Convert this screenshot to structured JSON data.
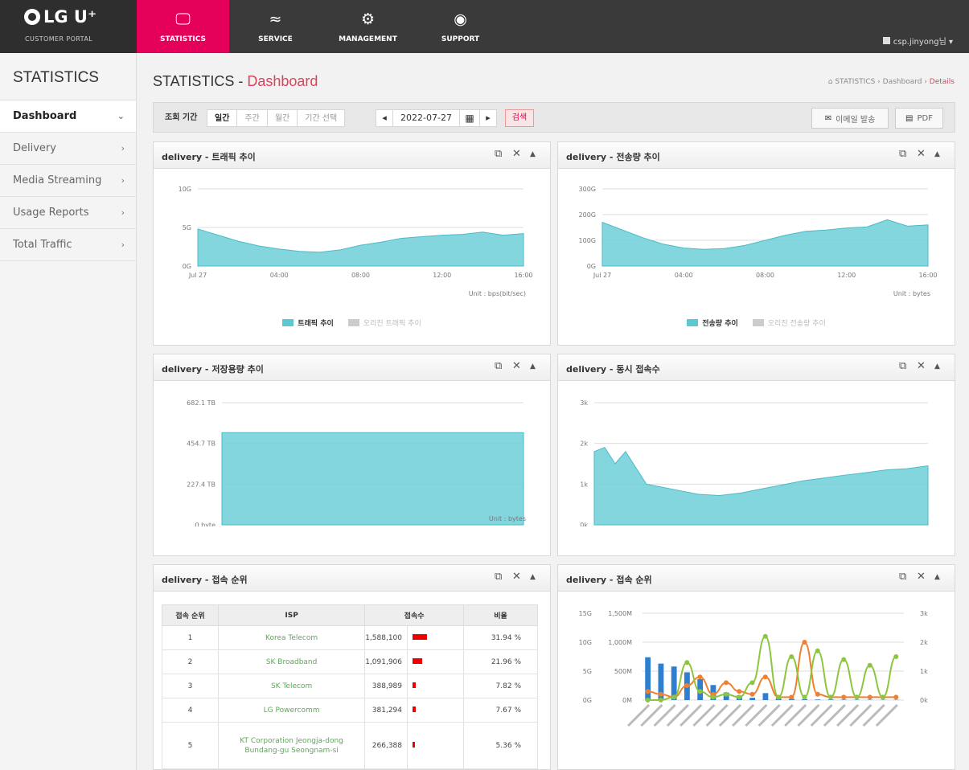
{
  "header": {
    "logo_text": "LG U⁺",
    "logo_sub": "CUSTOMER PORTAL",
    "nav": [
      {
        "label": "STATISTICS",
        "icon": "monitor-icon"
      },
      {
        "label": "SERVICE",
        "icon": "chart-line-icon"
      },
      {
        "label": "MANAGEMENT",
        "icon": "gear-icon"
      },
      {
        "label": "SUPPORT",
        "icon": "chat-icon"
      }
    ],
    "user": "csp.jinyong님 ▾"
  },
  "sidebar": {
    "title": "STATISTICS",
    "items": [
      {
        "label": "Dashboard",
        "chev": "⌄"
      },
      {
        "label": "Delivery",
        "chev": "›"
      },
      {
        "label": "Media Streaming",
        "chev": "›"
      },
      {
        "label": "Usage Reports",
        "chev": "›"
      },
      {
        "label": "Total Traffic",
        "chev": "›"
      }
    ]
  },
  "page": {
    "title_prefix": "STATISTICS - ",
    "title_highlight": "Dashboard",
    "breadcrumb": {
      "a": "⌂ STATISTICS › Dashboard › ",
      "b": "Details"
    }
  },
  "search": {
    "period_label": "조회 기간",
    "tabs": [
      "일간",
      "주간",
      "월간",
      "기간 선택"
    ],
    "prev": "◂",
    "date": "2022-07-27",
    "next": "▸",
    "search_btn": "검색",
    "email_btn": "이메일 발송",
    "pdf_btn": "PDF"
  },
  "panels": {
    "p1": {
      "title": "delivery - 트래픽 추이",
      "unit": "Unit : bps(bit/sec)",
      "legend": [
        "트래픽 추이",
        "오리진 트래픽 추이"
      ]
    },
    "p2": {
      "title": "delivery - 전송량 추이",
      "unit": "Unit : bytes",
      "legend": [
        "전송량 추이",
        "오리진 전송량 추이"
      ]
    },
    "p3": {
      "title": "delivery - 저장용량 추이",
      "unit": "Unit : bytes"
    },
    "p4": {
      "title": "delivery - 동시 접속수"
    },
    "p5": {
      "title": "delivery - 접속 순위"
    },
    "p6": {
      "title": "delivery - 접속 순위"
    }
  },
  "rank_table": {
    "headers": [
      "접속 순위",
      "ISP",
      "접속수",
      "비율"
    ],
    "rows": [
      {
        "rank": "1",
        "isp": "Korea Telecom",
        "count": "1,588,100",
        "pct": "31.94 %",
        "share": 31.94
      },
      {
        "rank": "2",
        "isp": "SK Broadband",
        "count": "1,091,906",
        "pct": "21.96 %",
        "share": 21.96
      },
      {
        "rank": "3",
        "isp": "SK Telecom",
        "count": "388,989",
        "pct": "7.82 %",
        "share": 7.82
      },
      {
        "rank": "4",
        "isp": "LG Powercomm",
        "count": "381,294",
        "pct": "7.67 %",
        "share": 7.67
      },
      {
        "rank": "5",
        "isp": "KT Corporation Jeongja-dong Bundang-gu Seongnam-si",
        "count": "266,388",
        "pct": "5.36 %",
        "share": 5.36
      }
    ]
  },
  "colors": {
    "accent": "#e5005a",
    "teal": "#5bc8d2",
    "blue": "#2f7fd1",
    "orange": "#f08030",
    "green": "#8cc63f"
  },
  "chart_data": [
    {
      "type": "area",
      "title": "delivery - 트래픽 추이",
      "x_ticks": [
        "Jul 27",
        "04:00",
        "08:00",
        "12:00",
        "16:00"
      ],
      "y_ticks": [
        "0G",
        "5G",
        "10G"
      ],
      "ylim": [
        0,
        10
      ],
      "x": [
        0,
        1,
        2,
        3,
        4,
        5,
        6,
        7,
        8,
        9,
        10,
        11,
        12,
        13,
        14,
        15,
        16
      ],
      "values": [
        4.8,
        4.0,
        3.2,
        2.6,
        2.2,
        1.9,
        1.8,
        2.1,
        2.7,
        3.1,
        3.6,
        3.8,
        4.0,
        4.1,
        4.4,
        4.0,
        4.2
      ]
    },
    {
      "type": "area",
      "title": "delivery - 전송량 추이",
      "x_ticks": [
        "Jul 27",
        "04:00",
        "08:00",
        "12:00",
        "16:00"
      ],
      "y_ticks": [
        "0G",
        "100G",
        "200G",
        "300G"
      ],
      "ylim": [
        0,
        300
      ],
      "x": [
        0,
        1,
        2,
        3,
        4,
        5,
        6,
        7,
        8,
        9,
        10,
        11,
        12,
        13,
        14,
        15,
        16
      ],
      "values": [
        170,
        140,
        110,
        85,
        70,
        65,
        68,
        80,
        100,
        120,
        135,
        140,
        148,
        152,
        180,
        155,
        160
      ]
    },
    {
      "type": "area",
      "title": "delivery - 저장용량 추이",
      "x_ticks": [
        "Jul 27",
        "04:00",
        "08:00",
        "12:00",
        "16:00"
      ],
      "y_ticks": [
        "0 byte",
        "227.4 TB",
        "454.7 TB",
        "682.1 TB"
      ],
      "ylim": [
        0,
        682.1
      ],
      "x": [
        0,
        16
      ],
      "values": [
        515,
        515
      ]
    },
    {
      "type": "area",
      "title": "delivery - 동시 접속수",
      "x_ticks": [
        "Jul 27",
        "04:00",
        "08:00",
        "12:00",
        "16:00"
      ],
      "y_ticks": [
        "0k",
        "1k",
        "2k",
        "3k"
      ],
      "ylim": [
        0,
        3
      ],
      "x": [
        0,
        0.5,
        1,
        1.5,
        2,
        2.5,
        3,
        4,
        5,
        6,
        7,
        8,
        9,
        10,
        11,
        12,
        13,
        14,
        15,
        16
      ],
      "values": [
        1.8,
        1.9,
        1.5,
        1.8,
        1.4,
        1.0,
        0.95,
        0.85,
        0.75,
        0.72,
        0.78,
        0.88,
        0.98,
        1.08,
        1.15,
        1.22,
        1.28,
        1.35,
        1.38,
        1.45
      ]
    },
    {
      "type": "bar+line",
      "title": "delivery - 접속 순위",
      "y_ticks_left_outer": [
        "0G",
        "5G",
        "10G",
        "15G"
      ],
      "y_ticks_left": [
        "0M",
        "500M",
        "1,000M",
        "1,500M"
      ],
      "y_ticks_right": [
        "0k",
        "1k",
        "2k",
        "3k"
      ],
      "bars": [
        740,
        630,
        580,
        480,
        360,
        260,
        130,
        80,
        40,
        120,
        30,
        20,
        15,
        10,
        10,
        8,
        6,
        6,
        5,
        5
      ],
      "orange": [
        0.3,
        0.2,
        0.1,
        0.5,
        0.8,
        0.2,
        0.6,
        0.3,
        0.2,
        0.8,
        0.1,
        0.1,
        2.0,
        0.2,
        0.1,
        0.1,
        0.1,
        0.1,
        0.1,
        0.1
      ],
      "green": [
        0,
        0,
        0.1,
        1.3,
        0.3,
        0.1,
        0.2,
        0.1,
        0.6,
        2.2,
        0.1,
        1.5,
        0.1,
        1.7,
        0.1,
        1.4,
        0.1,
        1.2,
        0.1,
        1.5
      ]
    }
  ]
}
